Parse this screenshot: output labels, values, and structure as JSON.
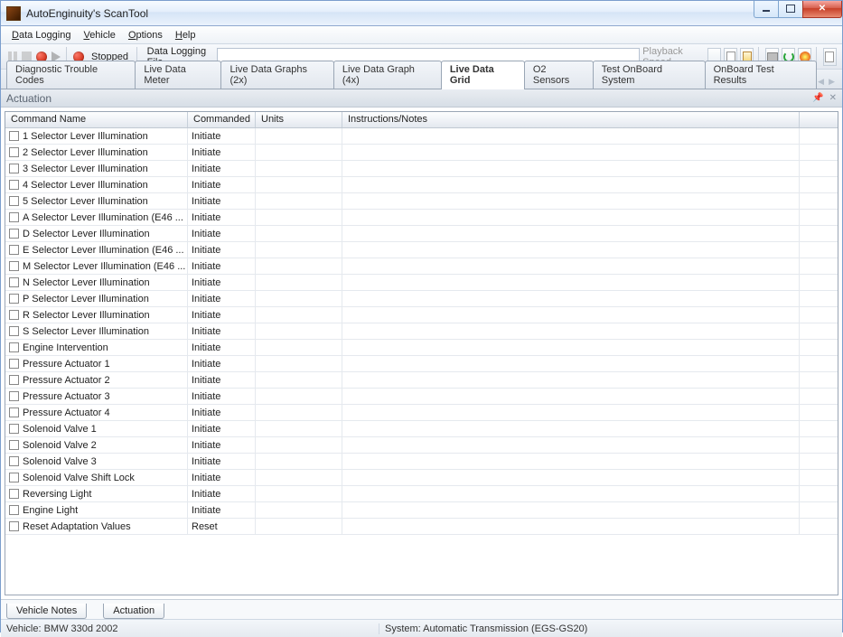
{
  "window": {
    "title": "AutoEnginuity's ScanTool"
  },
  "menu": [
    "Data Logging",
    "Vehicle",
    "Options",
    "Help"
  ],
  "toolbar": {
    "status": "Stopped",
    "file_label": "Data Logging File",
    "file_value": "",
    "playback_label": "Playback Speed"
  },
  "tabs": [
    "Diagnostic Trouble Codes",
    "Live Data Meter",
    "Live Data Graphs (2x)",
    "Live Data Graph (4x)",
    "Live Data Grid",
    "O2 Sensors",
    "Test OnBoard System",
    "OnBoard Test Results"
  ],
  "activeTab": "Live Data Grid",
  "panel": {
    "title": "Actuation"
  },
  "grid": {
    "headers": [
      "Command Name",
      "Commanded",
      "Units",
      "Instructions/Notes"
    ],
    "rows": [
      {
        "name": "1 Selector Lever Illumination",
        "cmd": "Initiate"
      },
      {
        "name": "2 Selector Lever Illumination",
        "cmd": "Initiate"
      },
      {
        "name": "3 Selector Lever Illumination",
        "cmd": "Initiate"
      },
      {
        "name": "4 Selector Lever Illumination",
        "cmd": "Initiate"
      },
      {
        "name": "5 Selector Lever Illumination",
        "cmd": "Initiate"
      },
      {
        "name": "A Selector Lever Illumination (E46 ...",
        "cmd": "Initiate"
      },
      {
        "name": "D Selector Lever Illumination",
        "cmd": "Initiate"
      },
      {
        "name": "E Selector Lever Illumination (E46 ...",
        "cmd": "Initiate"
      },
      {
        "name": "M Selector Lever Illumination (E46 ...",
        "cmd": "Initiate"
      },
      {
        "name": "N Selector Lever Illumination",
        "cmd": "Initiate"
      },
      {
        "name": "P Selector Lever Illumination",
        "cmd": "Initiate"
      },
      {
        "name": "R Selector Lever Illumination",
        "cmd": "Initiate"
      },
      {
        "name": "S Selector Lever Illumination",
        "cmd": "Initiate"
      },
      {
        "name": "Engine Intervention",
        "cmd": "Initiate"
      },
      {
        "name": "Pressure Actuator 1",
        "cmd": "Initiate"
      },
      {
        "name": "Pressure Actuator 2",
        "cmd": "Initiate"
      },
      {
        "name": "Pressure Actuator 3",
        "cmd": "Initiate"
      },
      {
        "name": "Pressure Actuator 4",
        "cmd": "Initiate"
      },
      {
        "name": "Solenoid Valve 1",
        "cmd": "Initiate"
      },
      {
        "name": "Solenoid Valve 2",
        "cmd": "Initiate"
      },
      {
        "name": "Solenoid Valve 3",
        "cmd": "Initiate"
      },
      {
        "name": "Solenoid Valve Shift Lock",
        "cmd": "Initiate"
      },
      {
        "name": "Reversing Light",
        "cmd": "Initiate"
      },
      {
        "name": "Engine Light",
        "cmd": "Initiate"
      },
      {
        "name": "Reset Adaptation Values",
        "cmd": "Reset"
      }
    ]
  },
  "bottomTabs": [
    "Vehicle Notes",
    "Actuation"
  ],
  "status": {
    "vehicle": "Vehicle: BMW  330d  2002",
    "system": "System: Automatic Transmission (EGS-GS20)"
  }
}
